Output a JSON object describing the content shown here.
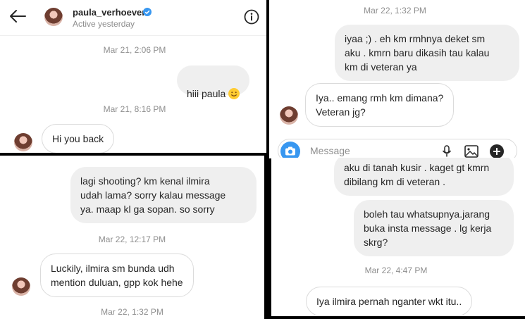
{
  "panel1": {
    "username": "paula_verhoeven",
    "status": "Active yesterday",
    "ts1": "Mar 21, 2:06 PM",
    "msg_me": "hiii paula",
    "ts2": "Mar 21, 8:16 PM",
    "msg_them": "Hi you back"
  },
  "panel2": {
    "ts": "Mar 22, 1:32 PM",
    "msg_me": "iyaa ;) . eh km rmhnya deket sm\naku . kmrn baru dikasih tau kalau\nkm di veteran ya",
    "msg_them": "Iya.. emang rmh km dimana?\nVeteran jg?",
    "input_placeholder": "Message"
  },
  "panel3": {
    "msg_me": "lagi shooting? km kenal ilmira\nudah lama? sorry kalau message\nya. maap kl ga sopan. so sorry",
    "ts1": "Mar 22, 12:17 PM",
    "msg_them": "Luckily, ilmira sm bunda udh\nmention duluan, gpp kok hehe",
    "ts2": "Mar 22, 1:32 PM"
  },
  "panel4": {
    "msg_me1": "aku di tanah kusir . kaget gt kmrn\ndibilang km di veteran .",
    "msg_me2": "boleh tau whatsupnya.jarang\nbuka insta message . lg kerja\nskrg?",
    "ts": "Mar 22, 4:47 PM",
    "msg_them": "Iya ilmira pernah nganter wkt itu.."
  },
  "colors": {
    "verified": "#3897f0",
    "camera": "#3897f0",
    "bubble_me": "#efefef"
  }
}
